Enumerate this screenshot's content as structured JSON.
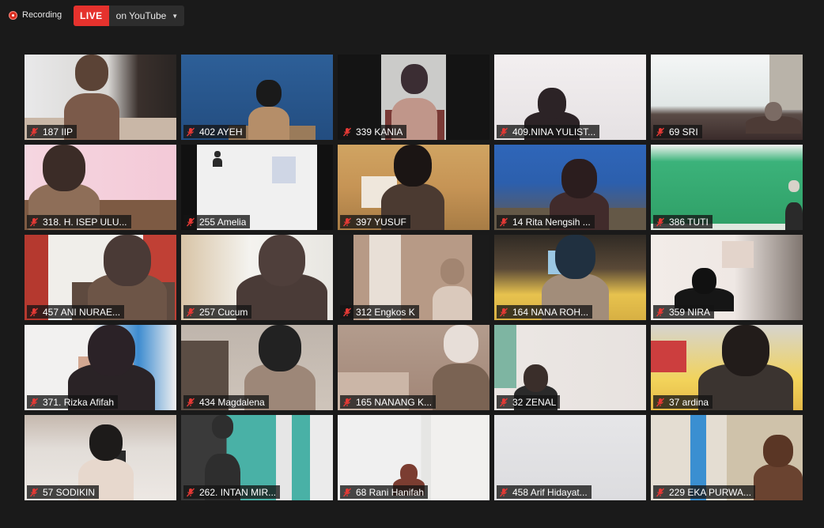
{
  "recording": {
    "label": "Recording"
  },
  "live": {
    "badge": "LIVE",
    "target": "on YouTube"
  },
  "colors": {
    "live_red": "#e5322d",
    "recording_red": "#d92d20",
    "background": "#1a1a1a",
    "muted_mic": "#e53935"
  },
  "participants": [
    {
      "name": "187 IIP",
      "muted": true
    },
    {
      "name": "402 AYEH",
      "muted": true
    },
    {
      "name": "339 KANIA",
      "muted": true
    },
    {
      "name": "409.NINA YULIST...",
      "muted": true
    },
    {
      "name": "69 SRI",
      "muted": true
    },
    {
      "name": "318. H. ISEP ULU...",
      "muted": true
    },
    {
      "name": "255 Amelia",
      "muted": true
    },
    {
      "name": "397 YUSUF",
      "muted": true
    },
    {
      "name": "14 Rita Nengsih ...",
      "muted": true
    },
    {
      "name": "386  TUTI",
      "muted": true
    },
    {
      "name": "457 ANI NURAE...",
      "muted": true
    },
    {
      "name": "257 Cucum",
      "muted": true
    },
    {
      "name": "312 Engkos K",
      "muted": true
    },
    {
      "name": "164 NANA ROH...",
      "muted": true
    },
    {
      "name": "359 NIRA",
      "muted": true
    },
    {
      "name": "371. Rizka Afifah",
      "muted": true
    },
    {
      "name": "434 Magdalena",
      "muted": true
    },
    {
      "name": "165 NANANG K...",
      "muted": true
    },
    {
      "name": "32 ZENAL",
      "muted": true
    },
    {
      "name": "37 ardina",
      "muted": true
    },
    {
      "name": "57 SODIKIN",
      "muted": true
    },
    {
      "name": "262. INTAN MIR...",
      "muted": true
    },
    {
      "name": "68 Rani Hanifah",
      "muted": true
    },
    {
      "name": "458 Arif Hidayat...",
      "muted": true
    },
    {
      "name": "229 EKA PURWA...",
      "muted": true
    }
  ]
}
